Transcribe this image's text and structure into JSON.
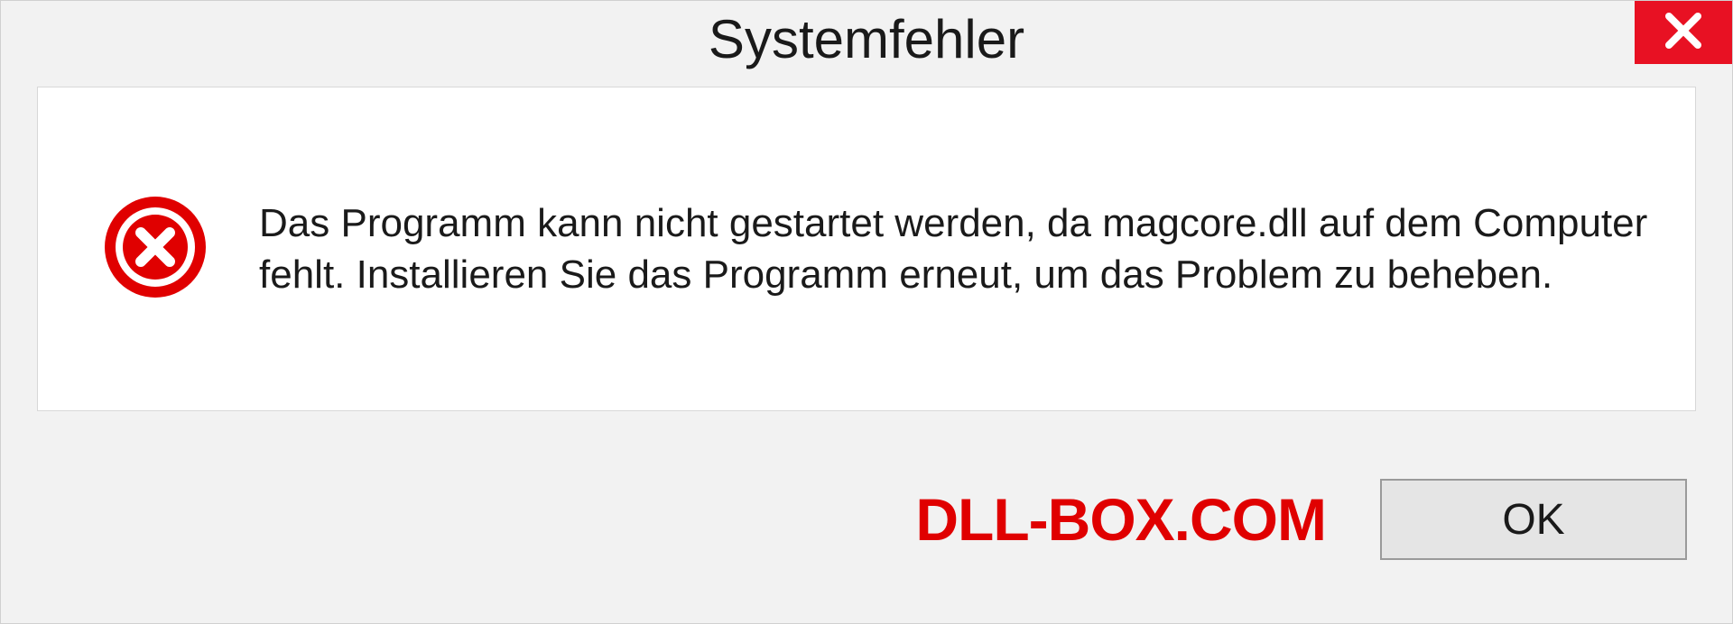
{
  "dialog": {
    "title": "Systemfehler",
    "message": "Das Programm kann nicht gestartet werden, da magcore.dll auf dem Computer fehlt. Installieren Sie das Programm erneut, um das Problem zu beheben.",
    "ok_label": "OK"
  },
  "watermark": "DLL-BOX.COM"
}
